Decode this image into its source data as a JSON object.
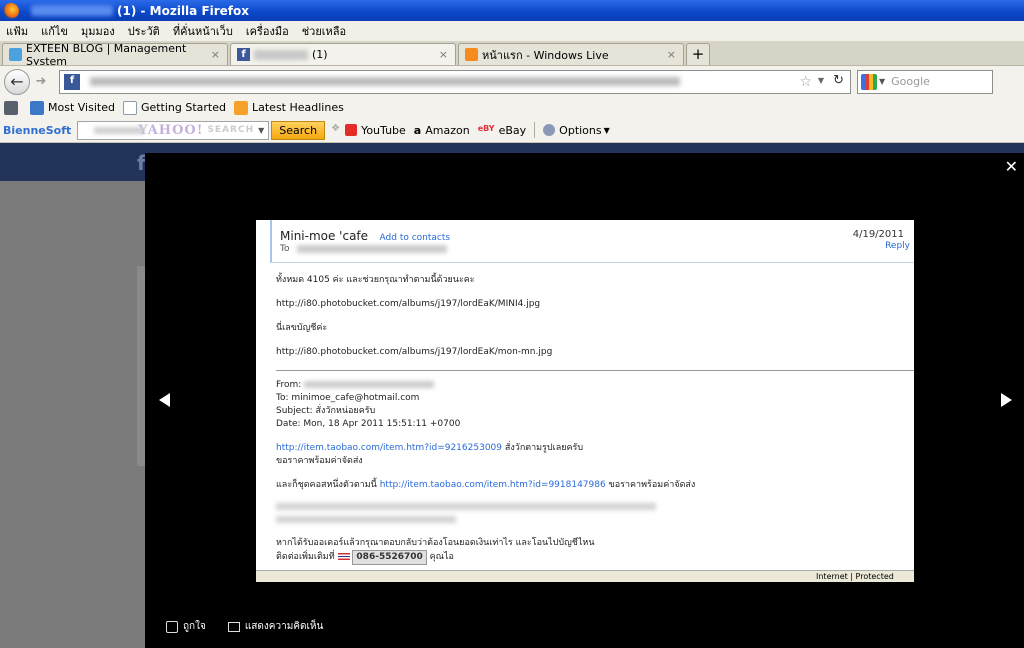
{
  "window": {
    "title": "(1) - Mozilla Firefox"
  },
  "menu": [
    "แฟ้ม",
    "แก้ไข",
    "มุมมอง",
    "ประวัติ",
    "ที่คั่นหน้าเว็บ",
    "เครื่องมือ",
    "ช่วยเหลือ"
  ],
  "tabs": [
    {
      "label": "EXTEEN BLOG | Management System",
      "close": "×"
    },
    {
      "label": "(1)",
      "close": "×"
    },
    {
      "label": "หน้าแรก - Windows Live",
      "close": "×"
    }
  ],
  "new_tab": "+",
  "search": {
    "placeholder": "Google"
  },
  "bookmarks": [
    "Most Visited",
    "Getting Started",
    "Latest Headlines"
  ],
  "toolbar": {
    "brand": "BienneSoft",
    "yahoo_logo": "YAHOO!",
    "yahoo_search": "SEARCH",
    "search_button": "Search",
    "items": [
      "YouTube",
      "Amazon",
      "eBay",
      "Options"
    ]
  },
  "email": {
    "sender": "Mini-moe 'cafe",
    "add_contacts": "Add to contacts",
    "to_label": "To",
    "date": "4/19/2011",
    "reply": "Reply",
    "line1": "ทั้งหมด 4105 ค่ะ และช่วยกรุณาทำตามนี้ด้วยนะคะ",
    "url1": "http://i80.photobucket.com/albums/j197/lordEaK/MINI4.jpg",
    "line2": "นี่เลขบัญชีค่ะ",
    "url2": "http://i80.photobucket.com/albums/j197/lordEaK/mon-mn.jpg",
    "from_label": "From:",
    "to_line": "To: minimoe_cafe@hotmail.com",
    "subject": "Subject: สั่งวักหน่อยครับ",
    "date_line": "Date: Mon, 18 Apr 2011 15:51:11 +0700",
    "taobao1": "http://item.taobao.com/item.htm?id=9216253009",
    "taobao1_after": "สั่งวักตามรูปเลยครับ",
    "price_line": "ขอราคาพร้อมค่าจัดส่ง",
    "extra_prefix": "และก็ชุดคอสหนึ่งตัวตามนี้",
    "taobao2": "http://item.taobao.com/item.htm?id=9918147986",
    "extra_suffix": "ขอราคาพร้อมค่าจัดส่ง",
    "footer1": "หากได้รับออเดอร์แล้วกรุณาตอบกลับว่าต้องโอนยอดเงินเท่าไร และโอนไปบัญชีไหน",
    "footer2_prefix": "ติดต่อเพิ่มเติมที่",
    "phone": "086-5526700",
    "footer2_suffix": "คุณไอ",
    "status_zone": "Internet | Protected Mode"
  },
  "photo_actions": {
    "like": "ถูกใจ",
    "comment": "แสดงความคิดเห็น"
  },
  "colors": {
    "fb_blue": "#3b5998",
    "link": "#2a6ad8",
    "overlay": "#000000"
  }
}
